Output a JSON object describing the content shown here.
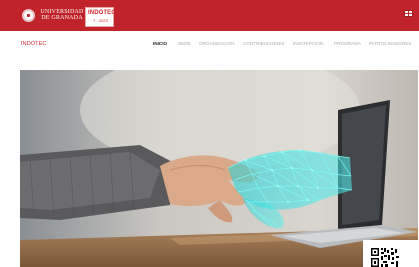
{
  "header": {
    "university_line1": "UNIVERSIDAD",
    "university_line2": "DE GRANADA",
    "logo_text": "INDOTEC",
    "logo_subtext": "7 · 2023",
    "accent_color": "#c0242a"
  },
  "site": {
    "title": "INDOTEC"
  },
  "nav": {
    "items": [
      {
        "label": "INICIO",
        "active": true
      },
      {
        "label": "SEDE",
        "active": false
      },
      {
        "label": "ORGANIZACION",
        "active": false
      },
      {
        "label": "CONTRIBUCIONES",
        "active": false
      },
      {
        "label": "INSCRIPCION",
        "active": false
      },
      {
        "label": "PROGRAMA",
        "active": false
      },
      {
        "label": "PATROCINADORES",
        "active": false
      }
    ]
  },
  "icons": {
    "crest": "university-crest-icon",
    "flag": "uk-flag-icon",
    "qr": "qr-code-icon"
  }
}
